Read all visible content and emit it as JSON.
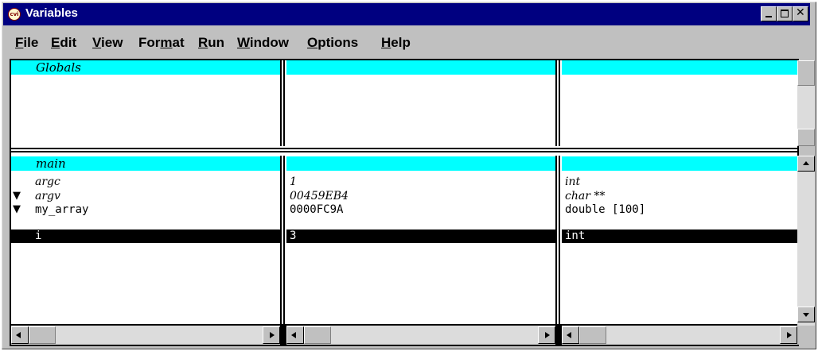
{
  "window": {
    "title": "Variables",
    "app_icon_text": "cvi"
  },
  "menubar": {
    "items": [
      {
        "pre": "",
        "u": "F",
        "post": "ile"
      },
      {
        "pre": "",
        "u": "E",
        "post": "dit"
      },
      {
        "pre": "",
        "u": "V",
        "post": "iew"
      },
      {
        "pre": "For",
        "u": "m",
        "post": "at"
      },
      {
        "pre": "",
        "u": "R",
        "post": "un"
      },
      {
        "pre": "",
        "u": "W",
        "post": "indow"
      },
      {
        "pre": "",
        "u": "O",
        "post": "ptions"
      },
      {
        "pre": "",
        "u": "H",
        "post": "elp"
      }
    ]
  },
  "globals_pane": {
    "header_name": "Globals"
  },
  "main_pane": {
    "header_name": "main",
    "rows": [
      {
        "expander": "",
        "name": "argc",
        "value": "1",
        "type": "int",
        "italic": true,
        "selected": false
      },
      {
        "expander": "▼",
        "name": "argv",
        "value": "00459EB4",
        "type": "char **",
        "italic": true,
        "selected": false
      },
      {
        "expander": "▼",
        "name": "my_array",
        "value": "0000FC9A",
        "type": "double [100]",
        "italic": false,
        "selected": false
      },
      {
        "expander": "",
        "name": "i",
        "value": "3",
        "type": "int",
        "italic": false,
        "selected": true
      }
    ]
  },
  "colors": {
    "titlebar": "#000080",
    "header_row": "#00ffff",
    "selection": "#000000",
    "chrome": "#c0c0c0"
  }
}
